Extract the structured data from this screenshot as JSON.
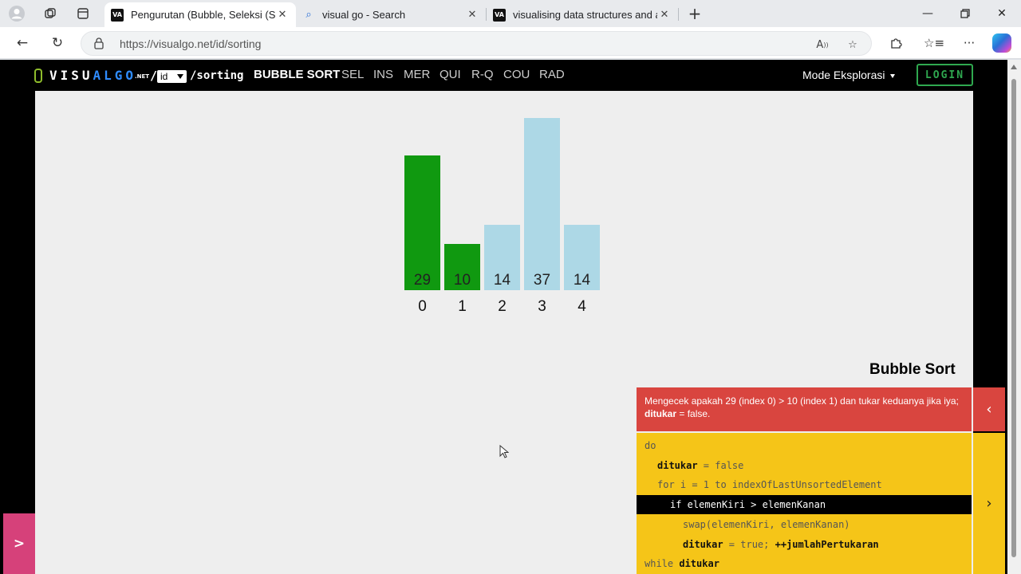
{
  "browser": {
    "tabs": [
      {
        "title": "Pengurutan (Bubble, Seleksi (Seleksi",
        "active": true,
        "favicon": "va"
      },
      {
        "title": "visual go - Search",
        "active": false,
        "favicon": "search"
      },
      {
        "title": "visualising data structures and algorithms",
        "active": false,
        "favicon": "va"
      }
    ],
    "url": "https://visualgo.net/id/sorting"
  },
  "site": {
    "logo": {
      "visu": "VISU",
      "algo": "ALGO",
      "net": ".NET"
    },
    "slash": "/",
    "language": "id",
    "path": "/sorting",
    "algo_tabs": [
      "BUBBLE SORT",
      "SEL",
      "INS",
      "MER",
      "QUI",
      "R-Q",
      "COU",
      "RAD"
    ],
    "mode": "Mode Eksplorasi",
    "login": "LOGIN"
  },
  "chart_data": {
    "type": "bar",
    "categories": [
      "0",
      "1",
      "2",
      "3",
      "4"
    ],
    "values": [
      29,
      10,
      14,
      37,
      14
    ],
    "bar_colors": [
      "#109910",
      "#109910",
      "#add8e6",
      "#add8e6",
      "#add8e6"
    ],
    "ylim": [
      0,
      37
    ]
  },
  "panel": {
    "title": "Bubble Sort",
    "status": {
      "prefix": "Mengecek apakah 29 (index 0) > 10 (index 1) dan tukar keduanya jika iya;",
      "bold": "ditukar",
      "suffix": "= false."
    },
    "code_lines": [
      {
        "indent": 0,
        "parts": [
          {
            "t": "do",
            "b": false
          }
        ]
      },
      {
        "indent": 1,
        "parts": [
          {
            "t": "ditukar",
            "b": true
          },
          {
            "t": " = false",
            "b": false
          }
        ]
      },
      {
        "indent": 1,
        "parts": [
          {
            "t": "for i = 1 to indexOfLastUnsortedElement",
            "b": false
          }
        ]
      },
      {
        "indent": 2,
        "parts": [
          {
            "t": "if elemenKiri > elemenKanan",
            "b": false
          }
        ],
        "highlight": true
      },
      {
        "indent": 3,
        "parts": [
          {
            "t": "swap(elemenKiri, elemenKanan)",
            "b": false
          }
        ]
      },
      {
        "indent": 3,
        "parts": [
          {
            "t": "ditukar",
            "b": true
          },
          {
            "t": " = true; ",
            "b": false
          },
          {
            "t": "++jumlahPertukaran",
            "b": true
          }
        ]
      },
      {
        "indent": 0,
        "parts": [
          {
            "t": "while ",
            "b": false
          },
          {
            "t": "ditukar",
            "b": true
          }
        ]
      }
    ]
  },
  "colors": {
    "accent_green": "#109910",
    "unsorted_blue": "#add8e6",
    "status_red": "#d9453f",
    "code_yellow": "#f5c518",
    "side_pink": "#d6417a"
  }
}
